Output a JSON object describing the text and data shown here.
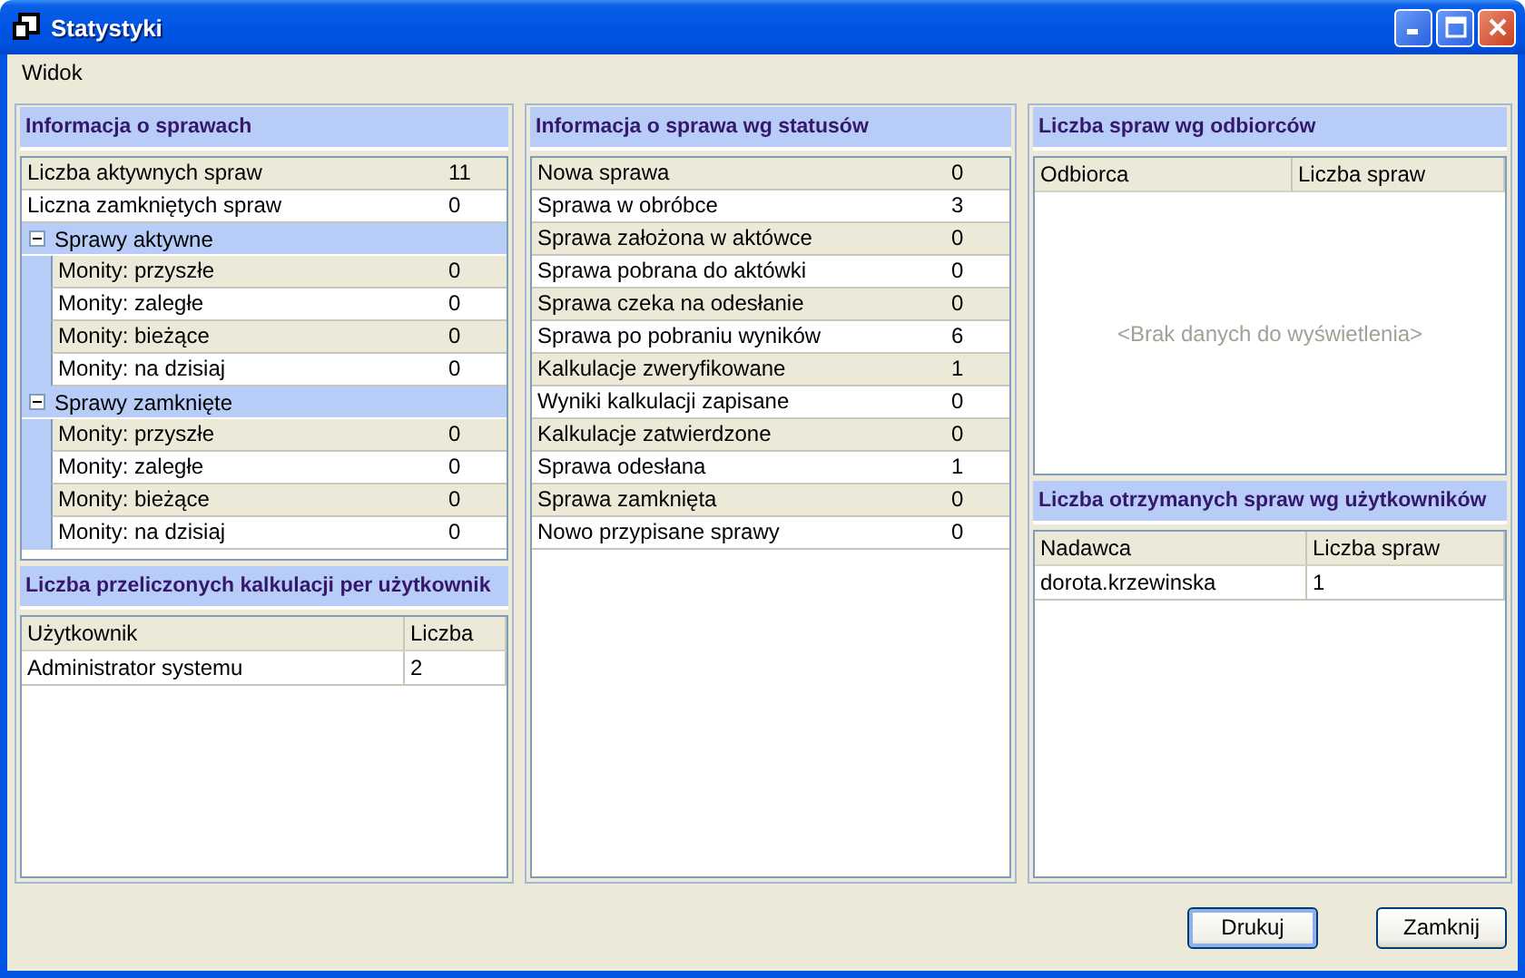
{
  "window": {
    "title": "Statystyki"
  },
  "menu": [
    "Widok"
  ],
  "case_info": {
    "title": "Informacja o sprawach",
    "rows": [
      {
        "label": "Liczba aktywnych spraw",
        "value": "11"
      },
      {
        "label": "Liczna zamkniętych spraw",
        "value": "0"
      }
    ],
    "groups": [
      {
        "label": "Sprawy aktywne",
        "expanded": true,
        "rows": [
          {
            "label": "Monity: przyszłe",
            "value": "0"
          },
          {
            "label": "Monity: zaległe",
            "value": "0"
          },
          {
            "label": "Monity: bieżące",
            "value": "0"
          },
          {
            "label": "Monity: na dzisiaj",
            "value": "0"
          }
        ]
      },
      {
        "label": "Sprawy zamknięte",
        "expanded": true,
        "rows": [
          {
            "label": "Monity: przyszłe",
            "value": "0"
          },
          {
            "label": "Monity: zaległe",
            "value": "0"
          },
          {
            "label": "Monity: bieżące",
            "value": "0"
          },
          {
            "label": "Monity: na dzisiaj",
            "value": "0"
          }
        ]
      }
    ]
  },
  "calculations": {
    "title": "Liczba przeliczonych kalkulacji per użytkownik",
    "columns": [
      "Użytkownik",
      "Liczba"
    ],
    "rows": [
      [
        "Administrator systemu",
        "2"
      ]
    ]
  },
  "status_info": {
    "title": "Informacja o sprawa wg statusów",
    "rows": [
      {
        "label": "Nowa sprawa",
        "value": "0"
      },
      {
        "label": "Sprawa w obróbce",
        "value": "3"
      },
      {
        "label": "Sprawa założona w aktówce",
        "value": "0"
      },
      {
        "label": "Sprawa pobrana do aktówki",
        "value": "0"
      },
      {
        "label": "Sprawa czeka na odesłanie",
        "value": "0"
      },
      {
        "label": "Sprawa po pobraniu wyników",
        "value": "6"
      },
      {
        "label": "Kalkulacje zweryfikowane",
        "value": "1"
      },
      {
        "label": "Wyniki kalkulacji zapisane",
        "value": "0"
      },
      {
        "label": "Kalkulacje zatwierdzone",
        "value": "0"
      },
      {
        "label": "Sprawa odesłana",
        "value": "1"
      },
      {
        "label": "Sprawa zamknięta",
        "value": "0"
      },
      {
        "label": "Nowo przypisane sprawy",
        "value": "0"
      }
    ]
  },
  "recipients": {
    "title": "Liczba spraw wg odbiorców",
    "columns": [
      "Odbiorca",
      "Liczba spraw"
    ],
    "empty_text": "<Brak danych do wyświetlenia>"
  },
  "received": {
    "title": "Liczba otrzymanych spraw wg użytkowników",
    "columns": [
      "Nadawca",
      "Liczba spraw"
    ],
    "rows": [
      [
        "dorota.krzewinska",
        "1"
      ]
    ]
  },
  "buttons": [
    {
      "label": "Drukuj",
      "default": true
    },
    {
      "label": "Zamknij",
      "default": false
    }
  ]
}
